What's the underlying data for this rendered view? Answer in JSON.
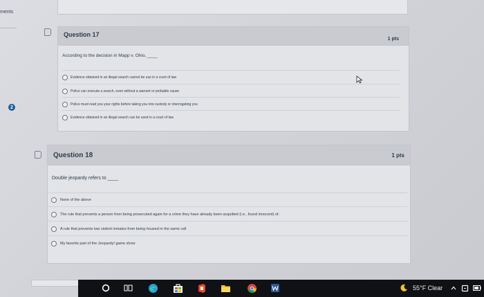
{
  "page": {
    "left_label": "ments",
    "sidebar_badge": "2"
  },
  "q17": {
    "title": "Question 17",
    "points": "1 pts",
    "prompt": "According to the decision in Mapp v. Ohio, ____",
    "answers": [
      "Evidence obtained in an illegal search cannot be use in a court of law",
      "Police can execute a search, even without a warrant or probable cause",
      "Police must read you your rights before taking you into custody or interrogating you",
      "Evidence obtained in an illegal search can be used in a court of law"
    ]
  },
  "q18": {
    "title": "Question 18",
    "points": "1 pts",
    "prompt": "Double jeopardy refers to ____",
    "answers": [
      "None of the above",
      "The rule that prevents a person from being prosecuted again for a crime they have already been acquitted (i.e., found innocent) of.",
      "A rule that prevents two violent inmates from being housed in the same cell",
      "My favorite part of the Jeopardy! game show"
    ]
  },
  "taskbar": {
    "weather": "55°F  Clear",
    "apps": [
      "cortana-icon",
      "task-view-icon",
      "edge-icon",
      "store-icon",
      "office-icon",
      "file-explorer-icon",
      "chrome-icon",
      "word-icon"
    ],
    "tray": [
      "chevron-up-icon",
      "network-icon",
      "battery-icon"
    ]
  }
}
